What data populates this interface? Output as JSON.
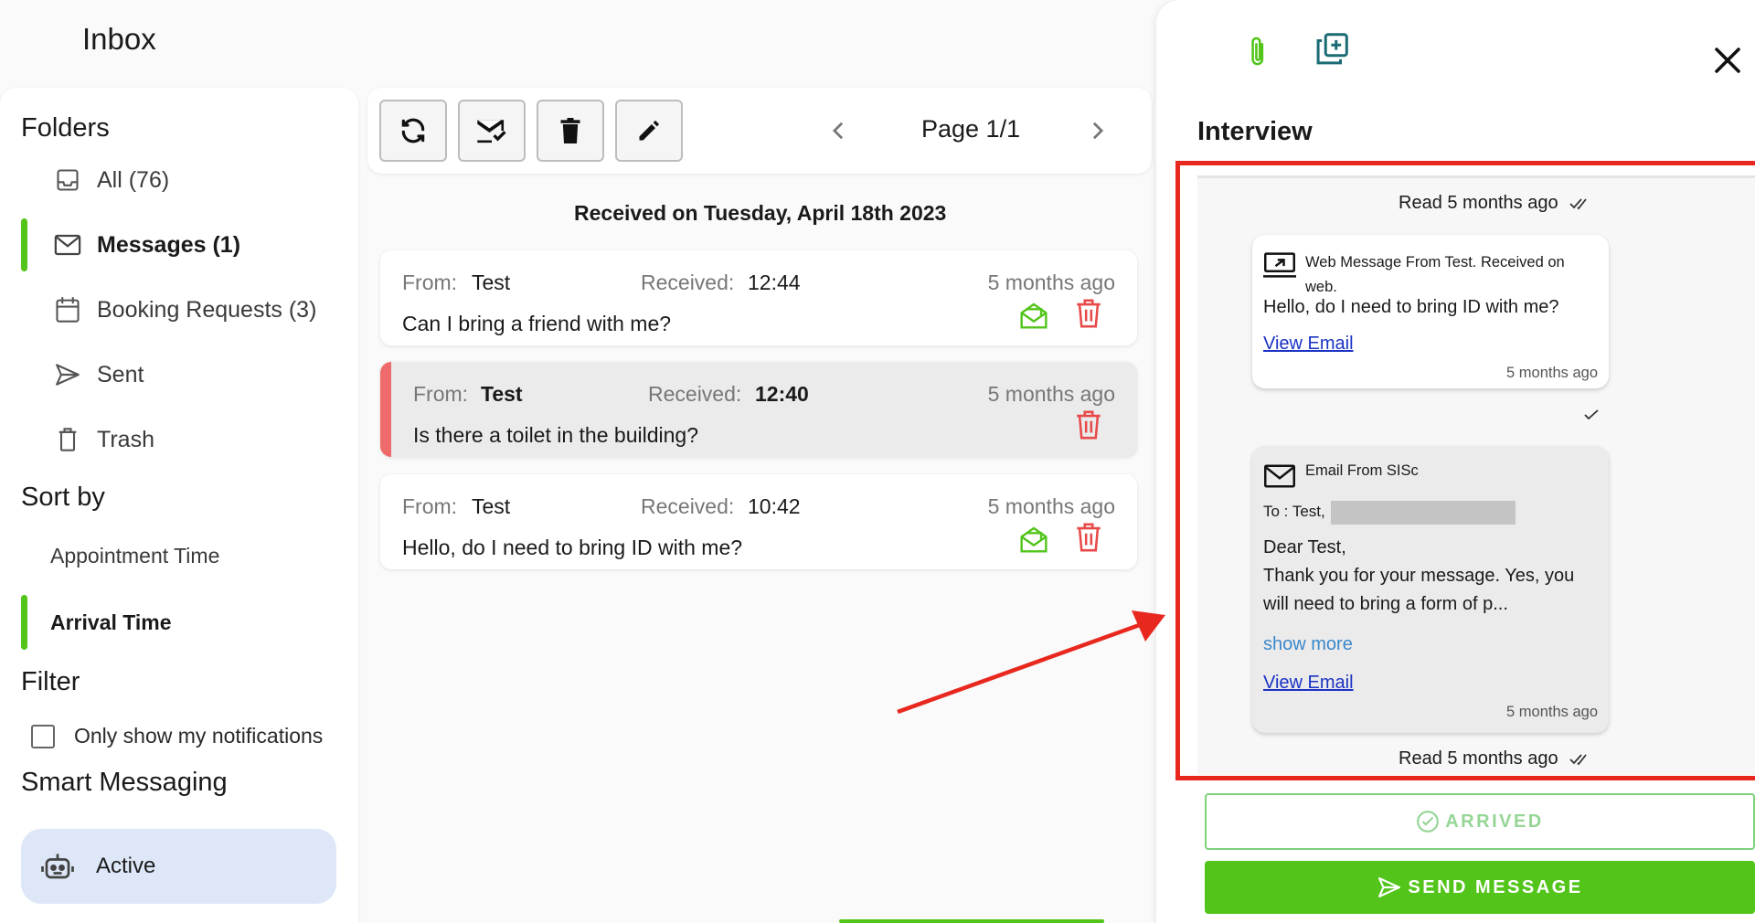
{
  "header": {
    "title": "Inbox"
  },
  "sidebar": {
    "folders_title": "Folders",
    "folders": [
      {
        "label": "All (76)",
        "icon": "inbox-icon",
        "active": false
      },
      {
        "label": "Messages (1)",
        "icon": "envelope-icon",
        "active": true
      },
      {
        "label": "Booking Requests (3)",
        "icon": "calendar-icon",
        "active": false
      },
      {
        "label": "Sent",
        "icon": "send-icon",
        "active": false
      },
      {
        "label": "Trash",
        "icon": "trash-icon",
        "active": false
      }
    ],
    "sort_title": "Sort by",
    "sort_options": [
      {
        "label": "Appointment Time",
        "active": false
      },
      {
        "label": "Arrival Time",
        "active": true
      }
    ],
    "filter_title": "Filter",
    "filter_label": "Only show my notifications",
    "smart_title": "Smart Messaging",
    "smart_status": "Active"
  },
  "toolbar": {
    "buttons": [
      "refresh-icon",
      "mark-read-icon",
      "delete-icon",
      "compose-icon"
    ],
    "page_label": "Page 1/1"
  },
  "list": {
    "date_header": "Received on Tuesday, April 18th 2023",
    "from_label": "From:",
    "received_label": "Received:",
    "messages": [
      {
        "from": "Test",
        "time": "12:44",
        "ago": "5 months ago",
        "subject": "Can I bring a friend with me?",
        "read_icon": true,
        "selected": false
      },
      {
        "from": "Test",
        "time": "12:40",
        "ago": "5 months ago",
        "subject": "Is there a toilet in the building?",
        "read_icon": false,
        "selected": true
      },
      {
        "from": "Test",
        "time": "10:42",
        "ago": "5 months ago",
        "subject": "Hello, do I need to bring ID with me?",
        "read_icon": true,
        "selected": false
      }
    ]
  },
  "panel": {
    "title": "Interview",
    "read_top": "Read 5 months ago",
    "web_message": {
      "header": "Web Message From Test. Received on web.",
      "body": "Hello, do I need to bring ID with me?",
      "link": "View Email",
      "ago": "5 months ago"
    },
    "email_message": {
      "header": "Email From SISc",
      "to": "To : Test, .",
      "greeting": "Dear Test,",
      "body": "Thank you for your message. Yes, you will need to bring a form of p...",
      "show_more": "show more",
      "link": "View Email",
      "ago": "5 months ago"
    },
    "read_bottom": "Read 5 months ago",
    "arrived_label": "ARRIVED",
    "send_label": "SEND MESSAGE"
  },
  "colors": {
    "accent_green": "#52c41a",
    "danger_red": "#e8281f",
    "link_blue": "#1a33c4"
  }
}
